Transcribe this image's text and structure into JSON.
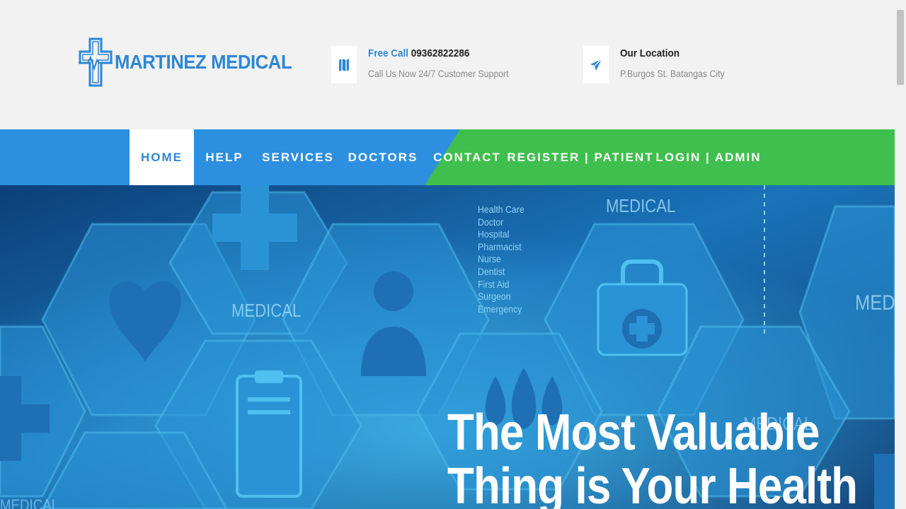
{
  "brand": {
    "name": "MARTINEZ MEDICAL",
    "color": "#2d86d6"
  },
  "contact": {
    "call_label": "Free Call",
    "call_number": "09362822286",
    "call_sub": "Call Us Now 24/7 Customer Support",
    "call_icon": "map-icon"
  },
  "location": {
    "title": "Our Location",
    "address": "P.Burgos St. Batangas City",
    "icon": "paper-plane-icon"
  },
  "nav": {
    "blue": "#2d8fe0",
    "green": "#3fbf4d",
    "items": [
      {
        "label": "HOME",
        "active": true
      },
      {
        "label": "HELP"
      },
      {
        "label": "SERVICES"
      },
      {
        "label": "DOCTORS"
      },
      {
        "label": "CONTACT"
      },
      {
        "label": "REGISTER | PATIENT"
      },
      {
        "label": "LOGIN | ADMIN"
      }
    ]
  },
  "hero": {
    "headline_line1": "The Most Valuable",
    "headline_line2": "Thing is Your Health",
    "watermark_words": [
      "MEDICAL",
      "MEDICAL",
      "MEDICAL",
      "MEDICAL",
      "MED"
    ],
    "list": [
      "Health Care",
      "Doctor",
      "Hospital",
      "Pharmacist",
      "Nurse",
      "Dentist",
      "First Aid",
      "Surgeon",
      "Emergency"
    ]
  }
}
